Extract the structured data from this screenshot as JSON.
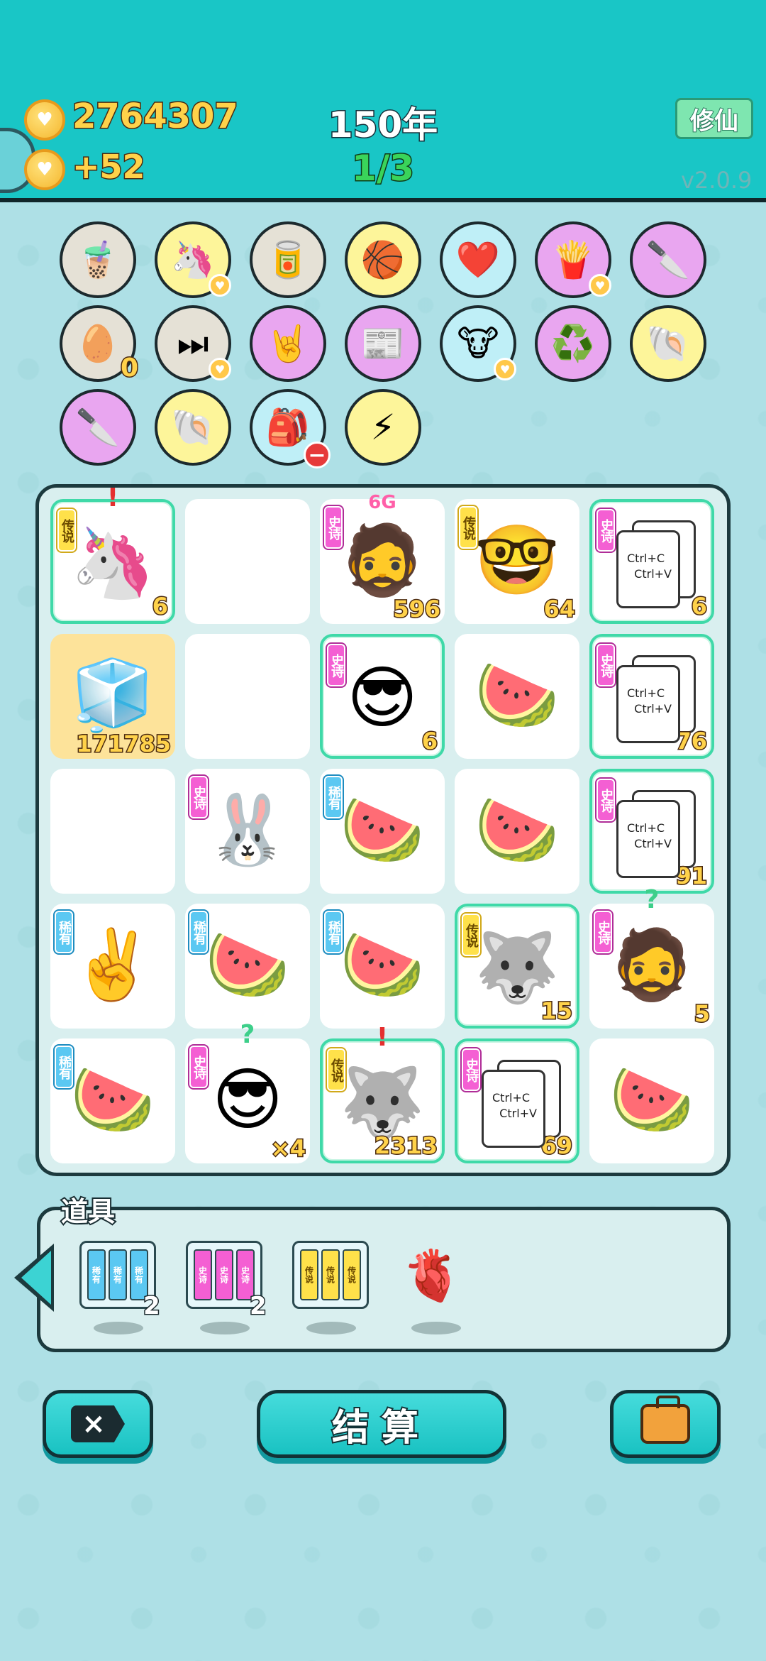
{
  "header": {
    "coins": "2764307",
    "coin_gain": "+52",
    "year": "150年",
    "round": "1/3",
    "mode_button": "修仙",
    "version": "v2.0.9"
  },
  "relics": [
    {
      "name": "bubble-tea",
      "icon": "🧋",
      "bg": "#e5e1d6"
    },
    {
      "name": "unicorn",
      "icon": "🦄",
      "bg": "#fdf59a",
      "heart": true
    },
    {
      "name": "pet-food",
      "icon": "🥫",
      "bg": "#e5e1d6"
    },
    {
      "name": "basketballs",
      "icon": "🏀",
      "bg": "#fdf59a"
    },
    {
      "name": "blood-bag",
      "icon": "❤️",
      "bg": "#bfeff7"
    },
    {
      "name": "fries",
      "icon": "🍟",
      "bg": "#e9a6f0",
      "heart": true
    },
    {
      "name": "cleaver",
      "icon": "🔪",
      "bg": "#e9a6f0"
    },
    {
      "name": "egg-tray",
      "icon": "🥚",
      "bg": "#e5e1d6",
      "count": "0"
    },
    {
      "name": "skip",
      "icon": "⏭",
      "bg": "#e5e1d6",
      "heart": true
    },
    {
      "name": "rock-hand",
      "icon": "🤘",
      "bg": "#e9a6f0"
    },
    {
      "name": "time-magazine",
      "icon": "📰",
      "bg": "#e9a6f0"
    },
    {
      "name": "cow-people",
      "icon": "🐮",
      "bg": "#bfeff7",
      "heart": true
    },
    {
      "name": "recycle",
      "icon": "♻️",
      "bg": "#e9a6f0"
    },
    {
      "name": "shell",
      "icon": "🐚",
      "bg": "#fdf59a"
    },
    {
      "name": "cleaver",
      "icon": "🔪",
      "bg": "#e9a6f0"
    },
    {
      "name": "shell",
      "icon": "🐚",
      "bg": "#fdf59a"
    },
    {
      "name": "sack",
      "icon": "🎒",
      "bg": "#bfeff7",
      "minus": true
    },
    {
      "name": "lightning",
      "icon": "⚡",
      "bg": "#fdf59a"
    }
  ],
  "board": [
    [
      {
        "tag": "传说",
        "tier": "legend",
        "icon": "🦄",
        "num": "6",
        "glow": true,
        "mark": "!",
        "markColor": "red"
      },
      {},
      {
        "tag": "史诗",
        "tier": "epic",
        "icon": "🧔",
        "num": "596",
        "above": "6G"
      },
      {
        "tag": "传说",
        "tier": "legend",
        "icon": "🤓",
        "num": "64"
      },
      {
        "tag": "史诗",
        "tier": "epic",
        "copy": true,
        "num": "6",
        "glow": true
      }
    ],
    [
      {
        "icon": "🧊",
        "num": "171785",
        "yellow": true
      },
      {},
      {
        "tag": "史诗",
        "tier": "epic",
        "icon": "😎",
        "num": "6",
        "glow": true
      },
      {
        "icon": "🍉"
      },
      {
        "tag": "史诗",
        "tier": "epic",
        "copy": true,
        "num": "76",
        "glow": true
      }
    ],
    [
      {},
      {
        "tag": "史诗",
        "tier": "epic",
        "icon": "🐰"
      },
      {
        "tag": "稀有",
        "tier": "rare",
        "icon": "🍉"
      },
      {
        "icon": "🍉"
      },
      {
        "tag": "史诗",
        "tier": "epic",
        "copy": true,
        "num": "91",
        "glow": true
      }
    ],
    [
      {
        "tag": "稀有",
        "tier": "rare",
        "icon": "✌️"
      },
      {
        "tag": "稀有",
        "tier": "rare",
        "icon": "🍉"
      },
      {
        "tag": "稀有",
        "tier": "rare",
        "icon": "🍉"
      },
      {
        "tag": "传说",
        "tier": "legend",
        "icon": "🐺",
        "num": "15",
        "glow": true
      },
      {
        "tag": "史诗",
        "tier": "epic",
        "icon": "🧔",
        "num": "5",
        "mark": "?",
        "markColor": "green"
      }
    ],
    [
      {
        "tag": "稀有",
        "tier": "rare",
        "icon": "🍉"
      },
      {
        "tag": "史诗",
        "tier": "epic",
        "icon": "😎",
        "num": "×4",
        "mark": "?",
        "markColor": "green"
      },
      {
        "tag": "传说",
        "tier": "legend",
        "icon": "🐺",
        "num": "2313",
        "glow": true,
        "mark": "!",
        "markColor": "red"
      },
      {
        "tag": "史诗",
        "tier": "epic",
        "copy": true,
        "num": "69",
        "glow": true
      },
      {
        "icon": "🍉"
      }
    ]
  ],
  "copy_text": {
    "line1": "Ctrl+C",
    "line2": "Ctrl+V"
  },
  "tools": {
    "label": "道具",
    "items": [
      {
        "name": "rare-card-pack",
        "slots": [
          "稀有",
          "稀有",
          "稀有"
        ],
        "color": "#5bc8f2",
        "count": "2"
      },
      {
        "name": "epic-card-pack",
        "slots": [
          "史诗",
          "史诗",
          "史诗"
        ],
        "color": "#f45fd3",
        "count": "2"
      },
      {
        "name": "legend-card-pack",
        "slots": [
          "传说",
          "传说",
          "传说"
        ],
        "color": "#ffe14a",
        "count": ""
      },
      {
        "name": "liver",
        "icon": "🫀",
        "count": ""
      }
    ]
  },
  "buttons": {
    "delete": "×",
    "settle": "结算"
  }
}
